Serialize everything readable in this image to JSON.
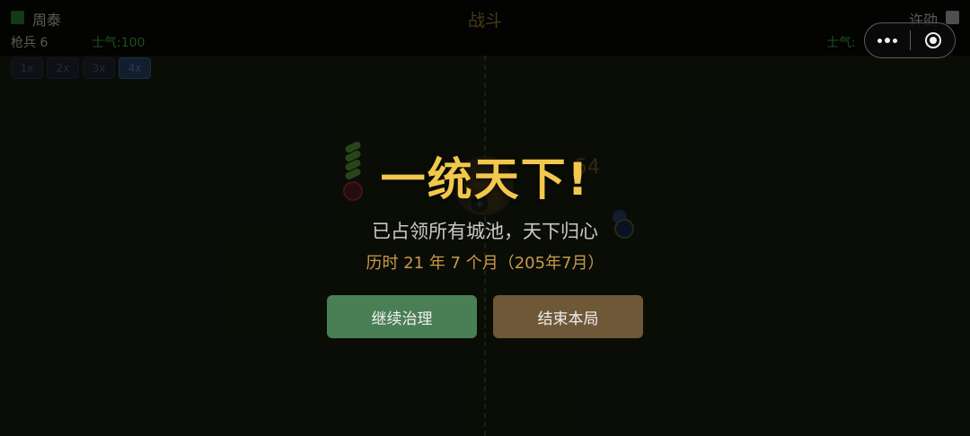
{
  "battle": {
    "title": "战斗",
    "left_player": {
      "name": "周泰",
      "troop": "枪兵 6",
      "morale": "士气:100",
      "color": "#1f5a1f"
    },
    "right_player": {
      "name": "许劭",
      "morale": "士气:",
      "color": "#7a7a7a"
    },
    "speeds": [
      {
        "label": "1x",
        "active": false
      },
      {
        "label": "2x",
        "active": false
      },
      {
        "label": "3x",
        "active": false
      },
      {
        "label": "4x",
        "active": true
      }
    ],
    "center_unit_marker": "+",
    "ghost_number": "54"
  },
  "capsule": {
    "more_icon": "more-dots-icon",
    "close_icon": "target-close-icon"
  },
  "victory": {
    "title": "一统天下!",
    "subtitle": "已占领所有城池，天下归心",
    "duration": "历时 21 年 7 个月（205年7月）",
    "continue_label": "继续治理",
    "end_label": "结束本局",
    "colors": {
      "title": "#f2c74e",
      "continue_button": "#4a7f55",
      "end_button": "#6e5837"
    }
  }
}
